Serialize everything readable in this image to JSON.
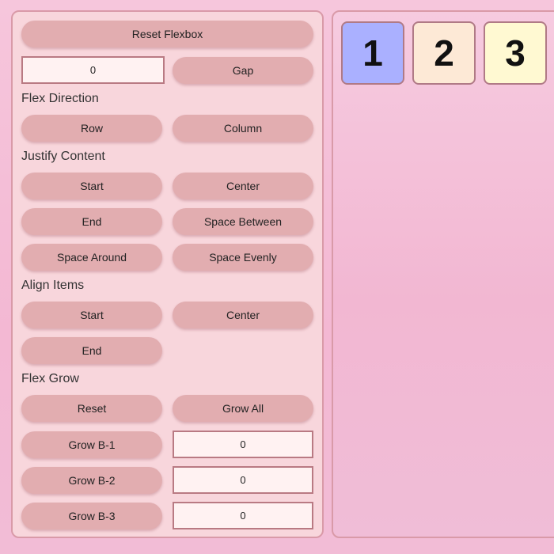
{
  "controls": {
    "reset_flexbox": "Reset Flexbox",
    "gap_value": "0",
    "gap_label": "Gap"
  },
  "flex_direction": {
    "title": "Flex Direction",
    "row": "Row",
    "column": "Column"
  },
  "justify_content": {
    "title": "Justify Content",
    "start": "Start",
    "center": "Center",
    "end": "End",
    "space_between": "Space Between",
    "space_around": "Space Around",
    "space_evenly": "Space Evenly"
  },
  "align_items": {
    "title": "Align Items",
    "start": "Start",
    "center": "Center",
    "end": "End"
  },
  "flex_grow": {
    "title": "Flex Grow",
    "reset": "Reset",
    "grow_all": "Grow All",
    "items": [
      {
        "label": "Grow B-1",
        "value": "0"
      },
      {
        "label": "Grow B-2",
        "value": "0"
      },
      {
        "label": "Grow B-3",
        "value": "0"
      }
    ]
  },
  "boxes": [
    {
      "label": "1",
      "color": "#aab0ff"
    },
    {
      "label": "2",
      "color": "#fde9d6"
    },
    {
      "label": "3",
      "color": "#fff9d2"
    }
  ]
}
